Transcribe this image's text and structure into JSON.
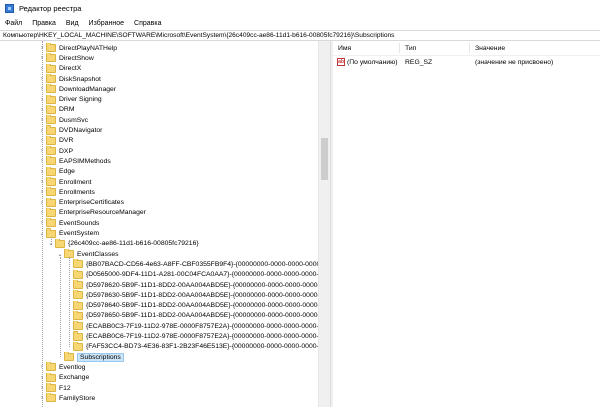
{
  "window": {
    "title": "Редактор реестра"
  },
  "menu": [
    "Файл",
    "Правка",
    "Вид",
    "Избранное",
    "Справка"
  ],
  "address": "Компьютер\\HKEY_LOCAL_MACHINE\\SOFTWARE\\Microsoft\\EventSystem\\{26c409cc-ae86-11d1-b616-00805fc79216}\\Subscriptions",
  "tree": [
    {
      "label": "DirectPlayNATHelp",
      "level": 0,
      "chev": ">"
    },
    {
      "label": "DirectShow",
      "level": 0,
      "chev": ">"
    },
    {
      "label": "DirectX",
      "level": 0,
      "chev": ">"
    },
    {
      "label": "DiskSnapshot",
      "level": 0,
      "chev": ">"
    },
    {
      "label": "DownloadManager",
      "level": 0,
      "chev": ">"
    },
    {
      "label": "Driver Signing",
      "level": 0,
      "chev": ">"
    },
    {
      "label": "DRM",
      "level": 0,
      "chev": ">"
    },
    {
      "label": "DusmSvc",
      "level": 0,
      "chev": ">"
    },
    {
      "label": "DVDNavigator",
      "level": 0,
      "chev": ">"
    },
    {
      "label": "DVR",
      "level": 0,
      "chev": ">"
    },
    {
      "label": "DXP",
      "level": 0,
      "chev": ">"
    },
    {
      "label": "EAPSIMMethods",
      "level": 0,
      "chev": ">"
    },
    {
      "label": "Edge",
      "level": 0,
      "chev": ">"
    },
    {
      "label": "Enrollment",
      "level": 0,
      "chev": ">"
    },
    {
      "label": "Enrollments",
      "level": 0,
      "chev": ">"
    },
    {
      "label": "EnterpriseCertificates",
      "level": 0,
      "chev": ">"
    },
    {
      "label": "EnterpriseResourceManager",
      "level": 0,
      "chev": ">"
    },
    {
      "label": "EventSounds",
      "level": 0,
      "chev": ">"
    },
    {
      "label": "EventSystem",
      "level": 0,
      "chev": "v"
    },
    {
      "label": "{26c409cc-ae86-11d1-b616-00805fc79216}",
      "level": 1,
      "chev": "v"
    },
    {
      "label": "EventClasses",
      "level": 2,
      "chev": "v"
    },
    {
      "label": "{BB07BACD-CD56-4e63-A8FF-CBF0355FB9F4}-{00000000-0000-0000-0000-0000",
      "level": 3,
      "chev": ""
    },
    {
      "label": "{D0565000-9DF4-11D1-A281-00C04FCA0AA7}-{00000000-0000-0000-0000-0000",
      "level": 3,
      "chev": ""
    },
    {
      "label": "{D5978620-5B9F-11D1-8DD2-00AA004ABD5E}-{00000000-0000-0000-0000-0000",
      "level": 3,
      "chev": ""
    },
    {
      "label": "{D5978630-5B9F-11D1-8DD2-00AA004ABD5E}-{00000000-0000-0000-0000-0000",
      "level": 3,
      "chev": ""
    },
    {
      "label": "{D5978640-5B9F-11D1-8DD2-00AA004ABD5E}-{00000000-0000-0000-0000-0000",
      "level": 3,
      "chev": ""
    },
    {
      "label": "{D5978650-5B9F-11D1-8DD2-00AA004ABD5E}-{00000000-0000-0000-0000-0000",
      "level": 3,
      "chev": ""
    },
    {
      "label": "{ECABB0C3-7F19-11D2-978E-0000F8757E2A}-{00000000-0000-0000-0000-0000",
      "level": 3,
      "chev": ""
    },
    {
      "label": "{ECABB0C6-7F19-11D2-978E-0000F8757E2A}-{00000000-0000-0000-0000-0000",
      "level": 3,
      "chev": ""
    },
    {
      "label": "{FAF53CC4-BD73-4E36-83F1-2B23F46E513E}-{00000000-0000-0000-0000-0000",
      "level": 3,
      "chev": ""
    },
    {
      "label": "Subscriptions",
      "level": 2,
      "chev": "",
      "selected": true
    },
    {
      "label": "Eventlog",
      "level": 0,
      "chev": ">"
    },
    {
      "label": "Exchange",
      "level": 0,
      "chev": ">"
    },
    {
      "label": "F12",
      "level": 0,
      "chev": ">"
    },
    {
      "label": "FamilyStore",
      "level": 0,
      "chev": ">"
    }
  ],
  "values": {
    "headers": {
      "name": "Имя",
      "type": "Тип",
      "data": "Значение"
    },
    "rows": [
      {
        "icon": "string-value-icon",
        "icon_text": "ab",
        "name": "(По умолчанию)",
        "type": "REG_SZ",
        "data": "(значение не присвоено)"
      }
    ]
  }
}
